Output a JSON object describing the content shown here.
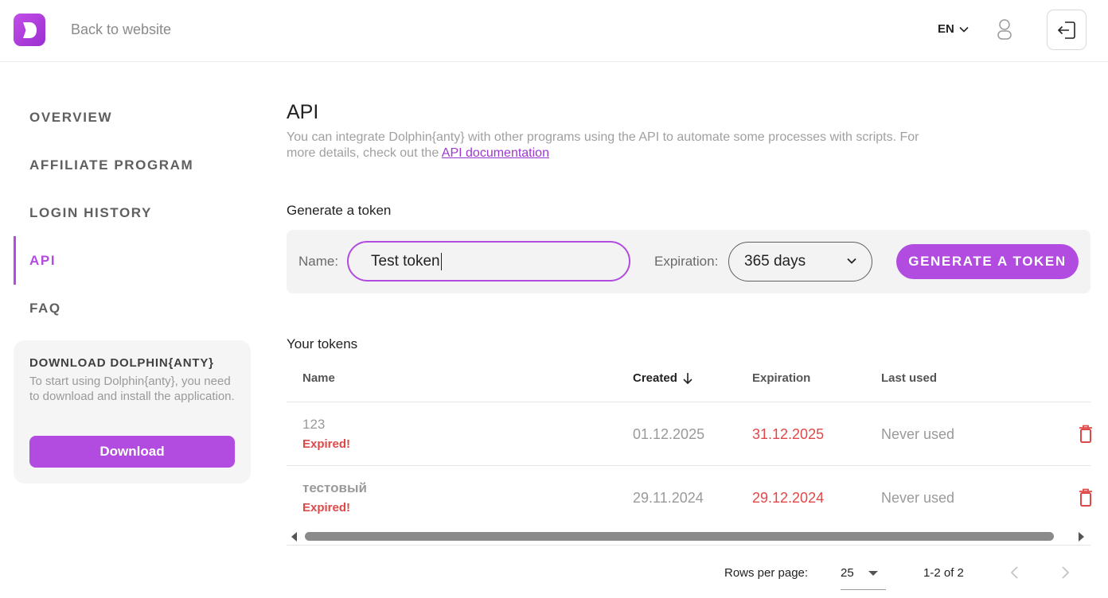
{
  "header": {
    "back_label": "Back to website",
    "language": "EN"
  },
  "sidebar": {
    "items": [
      {
        "label": "OVERVIEW"
      },
      {
        "label": "AFFILIATE PROGRAM"
      },
      {
        "label": "LOGIN HISTORY"
      },
      {
        "label": "API",
        "active": true
      },
      {
        "label": "FAQ"
      }
    ],
    "download_card": {
      "title": "DOWNLOAD DOLPHIN{ANTY}",
      "text": "To start using Dolphin{anty}, you need to download and install the application.",
      "button_label": "Download"
    }
  },
  "main": {
    "title": "API",
    "description": "You can integrate Dolphin{anty} with other programs using the API to automate some processes with scripts. For more details, check out the",
    "doc_link": "API documentation",
    "generate": {
      "section_title": "Generate a token",
      "name_label": "Name:",
      "name_value": "Test token",
      "expiration_label": "Expiration:",
      "expiration_value": "365 days",
      "button_label": "GENERATE A TOKEN"
    },
    "tokens": {
      "section_title": "Your tokens",
      "columns": {
        "name": "Name",
        "created": "Created",
        "expiration": "Expiration",
        "last_used": "Last used"
      },
      "rows": [
        {
          "name": "123",
          "status": "Expired!",
          "created": "01.12.2025",
          "expiration": "31.12.2025",
          "last_used": "Never used"
        },
        {
          "name": "тестовый",
          "status": "Expired!",
          "created": "29.11.2024",
          "expiration": "29.12.2024",
          "last_used": "Never used"
        }
      ]
    },
    "pagination": {
      "rows_per_page_label": "Rows per page:",
      "rows_per_page_value": "25",
      "range": "1-2 of 2"
    }
  },
  "colors": {
    "accent": "#b24be0",
    "expired": "#e04848"
  }
}
